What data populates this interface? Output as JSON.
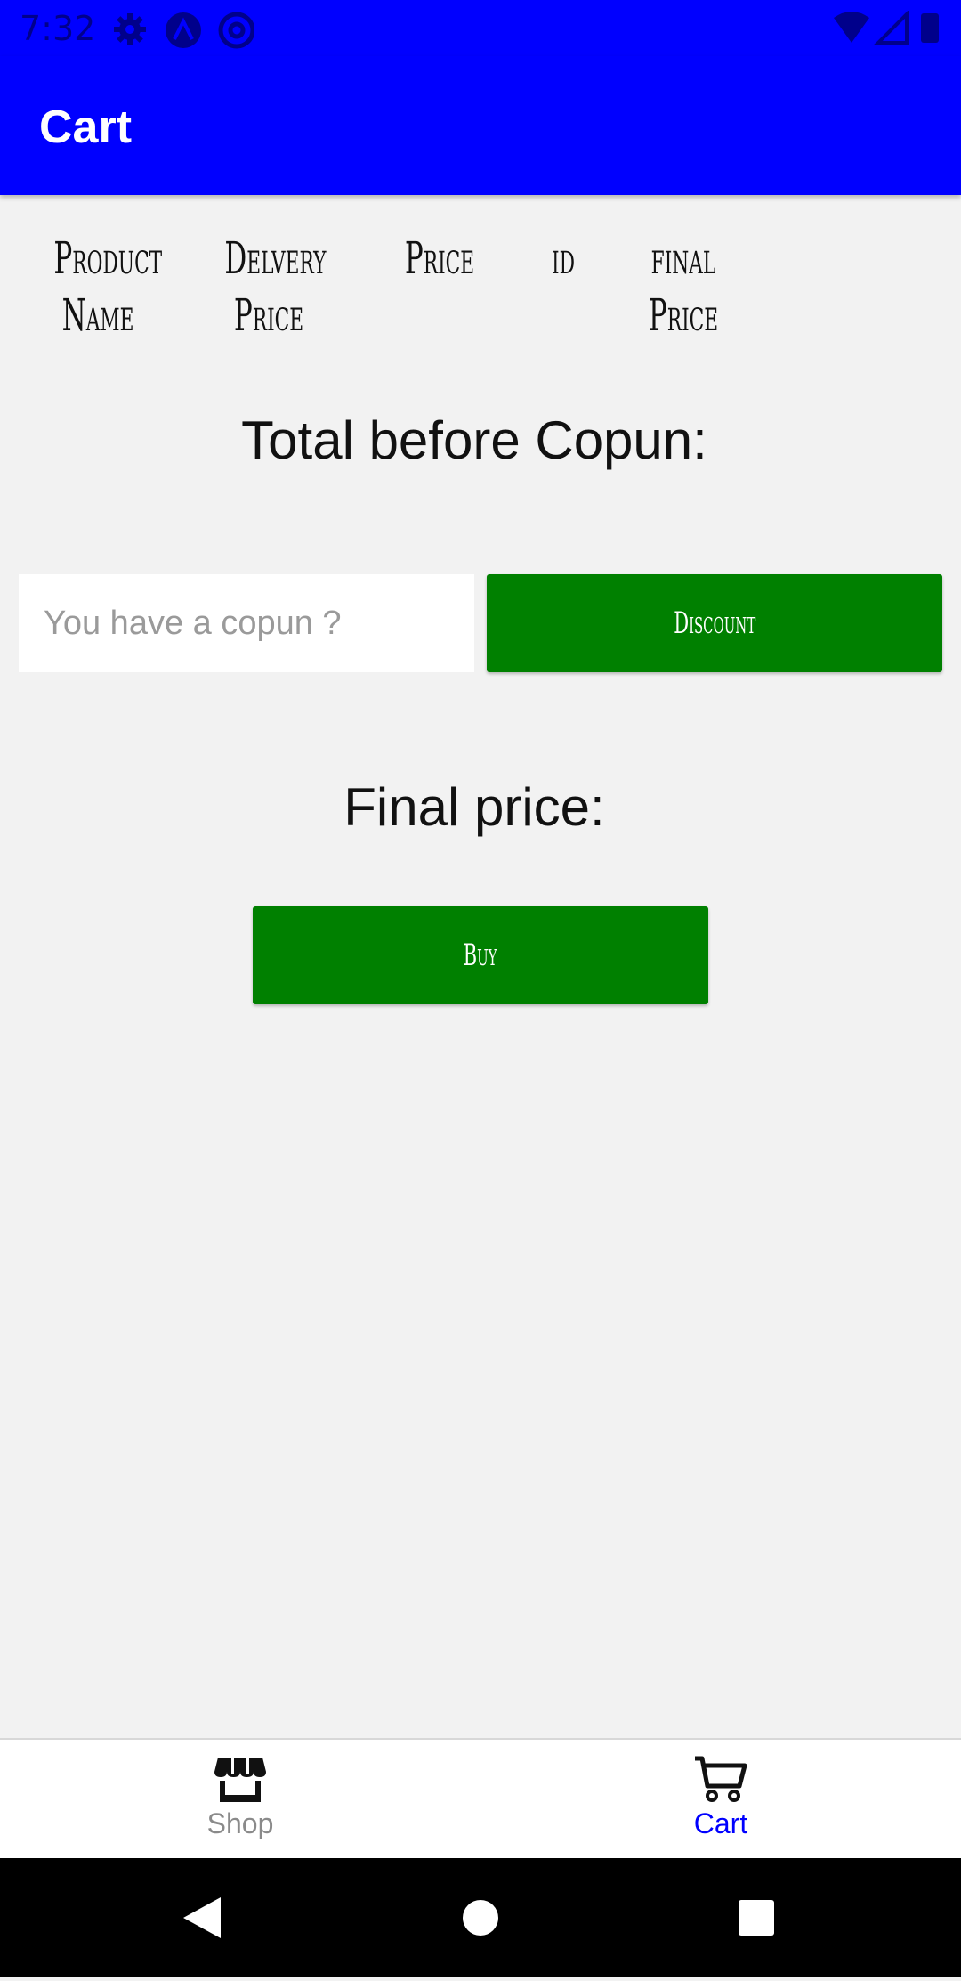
{
  "status_bar": {
    "time": "7:32",
    "left_icons": [
      "gear-icon",
      "a-circle-icon",
      "at-sign-icon"
    ],
    "right_icons": [
      "wifi-icon",
      "signal-icon",
      "battery-icon"
    ]
  },
  "app_bar": {
    "title": "Cart",
    "color": "#0000ff"
  },
  "table_header": {
    "columns": [
      "Product\nName",
      "Delvery\nPrice",
      "Price",
      "id",
      "final\nPrice"
    ]
  },
  "summary": {
    "total_before_coupon": "Total before Copun:",
    "final_price": "Final price:"
  },
  "coupon": {
    "placeholder": "You have a copun ?",
    "value": ""
  },
  "buttons": {
    "discount": "Discount",
    "buy": "Buy",
    "color": "#008000"
  },
  "bottom_nav": {
    "items": [
      {
        "label": "Shop",
        "icon": "store-icon",
        "active": false
      },
      {
        "label": "Cart",
        "icon": "cart-icon",
        "active": true
      }
    ],
    "active_color": "#0000ff",
    "inactive_color": "#8a8a8a"
  },
  "system_nav": {
    "icons": [
      "back-icon",
      "home-icon",
      "recents-icon"
    ]
  }
}
